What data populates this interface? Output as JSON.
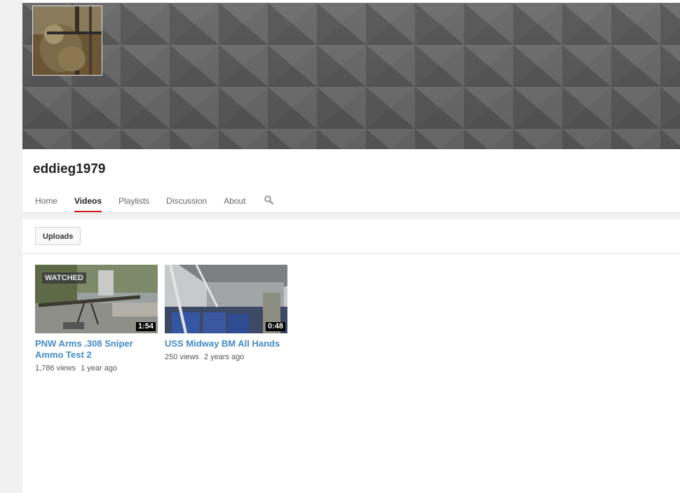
{
  "channel": {
    "name": "eddieg1979"
  },
  "tabs": [
    {
      "label": "Home"
    },
    {
      "label": "Videos"
    },
    {
      "label": "Playlists"
    },
    {
      "label": "Discussion"
    },
    {
      "label": "About"
    }
  ],
  "active_tab": "Videos",
  "search_icon": "search-icon",
  "subbar": {
    "uploads_label": "Uploads"
  },
  "videos": [
    {
      "title": "PNW Arms .308 Sniper Ammo Test 2",
      "duration": "1:54",
      "watched_label": "WATCHED",
      "views": "1,786 views",
      "age": "1 year ago"
    },
    {
      "title": "USS Midway BM All Hands",
      "duration": "0:48",
      "views": "250 views",
      "age": "2 years ago"
    }
  ],
  "colors": {
    "accent_red": "#cc181e",
    "link_blue": "#438bc5",
    "banner_gray": "#6d6d6d"
  }
}
